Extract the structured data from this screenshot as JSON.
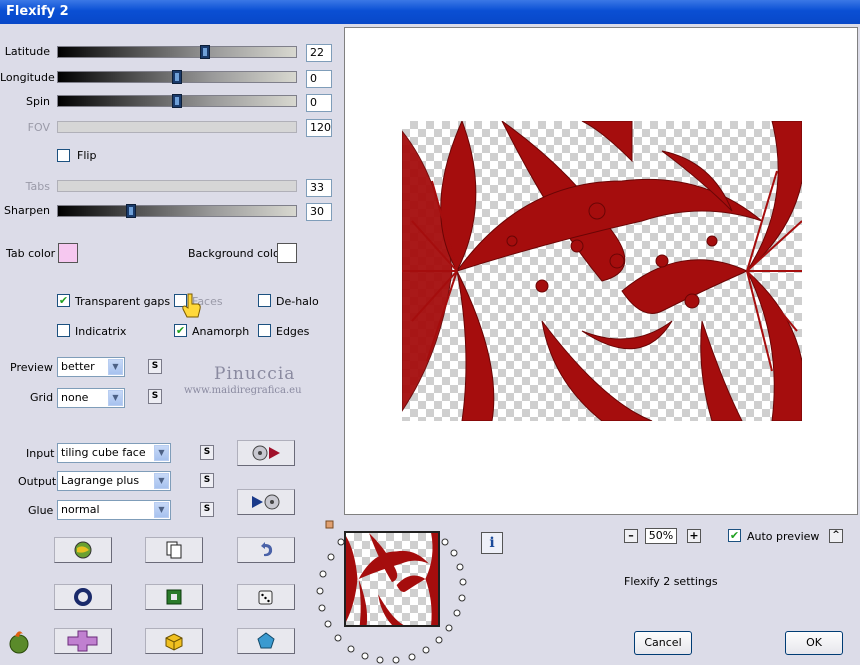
{
  "window": {
    "title": "Flexify 2"
  },
  "sliders": [
    {
      "label": "Latitude",
      "value": "22",
      "level": 0.61,
      "enabled": true
    },
    {
      "label": "Longitude",
      "value": "0",
      "level": 0.5,
      "enabled": true
    },
    {
      "label": "Spin",
      "value": "0",
      "level": 0.5,
      "enabled": true
    },
    {
      "label": "FOV",
      "value": "120",
      "enabled": false
    },
    {
      "label": "Tabs",
      "value": "33",
      "enabled": false
    },
    {
      "label": "Sharpen",
      "value": "30",
      "level": 0.3,
      "enabled": true
    }
  ],
  "flip": {
    "label": "Flip",
    "checked": false
  },
  "colors": {
    "tab_color_label": "Tab color",
    "tab_color": "#f6c8f0",
    "background_color_label": "Background color",
    "background_color": "#ffffff"
  },
  "options": {
    "transparent_gaps": {
      "label": "Transparent gaps",
      "checked": true
    },
    "faces": {
      "label": "Faces",
      "checked": false
    },
    "de_halo": {
      "label": "De-halo",
      "checked": false
    },
    "indicatrix": {
      "label": "Indicatrix",
      "checked": false
    },
    "anamorph": {
      "label": "Anamorph",
      "checked": true
    },
    "edges": {
      "label": "Edges",
      "checked": false
    }
  },
  "preview": {
    "label": "Preview",
    "value": "better"
  },
  "grid": {
    "label": "Grid",
    "value": "none"
  },
  "input": {
    "label": "Input",
    "value": "tiling cube face"
  },
  "output": {
    "label": "Output",
    "value": "Lagrange plus"
  },
  "glue": {
    "label": "Glue",
    "value": "normal"
  },
  "watermark": {
    "name": "Pinuccia",
    "site": "www.maidiregrafica.eu"
  },
  "zoom": {
    "value": "50%",
    "minus": "–",
    "plus": "+"
  },
  "auto_preview": {
    "label": "Auto preview",
    "checked": true
  },
  "settings_text": "Flexify 2 settings",
  "buttons": {
    "cancel": "Cancel",
    "ok": "OK",
    "info": "i",
    "s": "S",
    "expand": "^"
  },
  "accent": {
    "red": "#a50d0d",
    "title": "#0a4fd4"
  }
}
